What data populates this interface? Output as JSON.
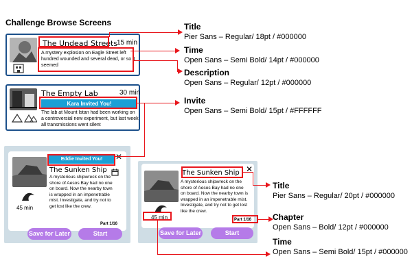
{
  "page": {
    "heading": "Challenge Browse Screens"
  },
  "cards": {
    "undead": {
      "title": "The Undead Streets",
      "time": "15 min",
      "description": "A mystery explosion on Eagle Street left hundred wounded and several dead, or so it seemed"
    },
    "lab": {
      "title": "The Empty Lab",
      "time": "30 min",
      "invite": "Kara Invited You!",
      "description": "The lab at Mount Istan had been working on a controversial new experiment, but last week all transmissions went silent"
    }
  },
  "dialogs": {
    "left": {
      "invite": "Eddie Invited You!",
      "title": "The Sunken Ship",
      "description": "A mysterious shipwreck on the shore of Aesos Bay had no one on board. Now the nearby town is wrapped in an impenetrable mist. Investigate, and try not to get lost like the crew.",
      "time": "45 min",
      "chapter": "Part 1/16",
      "save_label": "Save for Later",
      "start_label": "Start"
    },
    "right": {
      "title": "The Sunken Ship",
      "description": "A mysterious shipwreck on the shore of Aesos Bay had no one on board. Now the nearby town is wrapped in an impenetrable mist. Investigate, and try not to get lost like the crew.",
      "time": "45 min",
      "chapter": "Part 1/16",
      "save_label": "Save for Later",
      "start_label": "Start"
    }
  },
  "annotations": {
    "title1": {
      "heading": "Title",
      "spec": "Pier Sans – Regular/ 18pt / #000000"
    },
    "time1": {
      "heading": "Time",
      "spec": "Open Sans – Semi Bold/ 14pt / #000000"
    },
    "desc1": {
      "heading": "Description",
      "spec": "Open Sans – Regular/ 12pt / #000000"
    },
    "invite": {
      "heading": "Invite",
      "spec": "Open Sans – Semi Bold/ 15pt / #FFFFFF"
    },
    "title2": {
      "heading": "Title",
      "spec": "Pier Sans – Regular/ 20pt / #000000"
    },
    "chapter": {
      "heading": "Chapter",
      "spec": "Open Sans – Bold/ 12pt / #000000"
    },
    "time2": {
      "heading": "Time",
      "spec": "Open Sans – Semi Bold/ 15pt / #000000"
    }
  },
  "icons": {
    "close": "close-icon",
    "calendar": "calendar-icon",
    "wave": "wave-icon",
    "tents": "tent-icons",
    "trees": "tree-icons"
  },
  "colors": {
    "annotation": "#e8161c",
    "invite": "#1aa0d6",
    "button": "#b57be8",
    "card_border": "#1b4f8a",
    "panel_bg": "#cfdde5"
  }
}
